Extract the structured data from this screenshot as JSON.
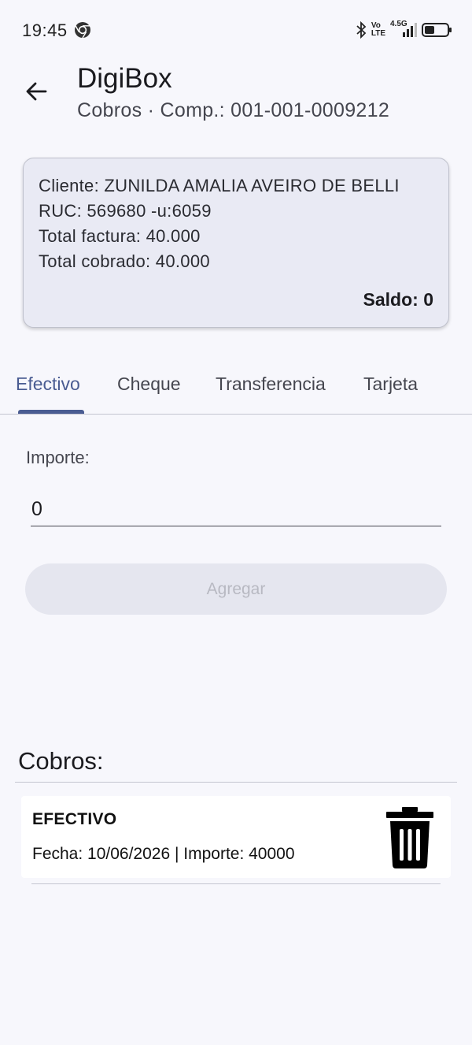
{
  "status_bar": {
    "time": "19:45",
    "network_top": "Vo",
    "network_bottom": "LTE",
    "signal_type": "4.5G"
  },
  "header": {
    "title": "DigiBox",
    "subtitle": "Cobros · Comp.: 001-001-0009212"
  },
  "info_card": {
    "cliente": "Cliente: ZUNILDA AMALIA AVEIRO DE BELLI",
    "ruc": "RUC: 569680 -u:6059",
    "total_factura": "Total factura: 40.000",
    "total_cobrado": "Total cobrado: 40.000",
    "saldo": "Saldo: 0"
  },
  "tabs": [
    {
      "label": "Efectivo",
      "active": true
    },
    {
      "label": "Cheque",
      "active": false
    },
    {
      "label": "Transferencia",
      "active": false
    },
    {
      "label": "Tarjeta",
      "active": false
    }
  ],
  "form": {
    "importe_label": "Importe:",
    "importe_value": "0",
    "add_label": "Agregar"
  },
  "cobros": {
    "title": "Cobros:",
    "items": [
      {
        "type": "EFECTIVO",
        "detail": "Fecha: 10/06/2026 | Importe: 40000"
      }
    ]
  },
  "colors": {
    "accent": "#4a5c92",
    "background": "#f7f7fc",
    "card": "#e9eaf4"
  },
  "icons": [
    "chrome-icon",
    "bluetooth-icon",
    "signal-icon",
    "battery-icon",
    "back-arrow-icon",
    "trash-icon"
  ]
}
